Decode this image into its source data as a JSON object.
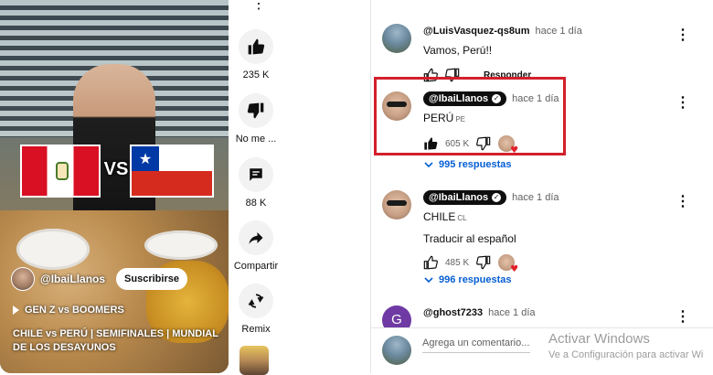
{
  "video": {
    "channel_name": "@IbaiLlanos",
    "subscribe_label": "Suscribirse",
    "playlist_label": "GEN Z vs BOOMERS",
    "title": "CHILE vs PERÚ | SEMIFINALES | MUNDIAL DE LOS DESAYUNOS",
    "vs_text": "VS",
    "flag_star": "★"
  },
  "actions": {
    "like_count": "235 K",
    "dislike_label": "No me ...",
    "comment_count": "88 K",
    "share_label": "Compartir",
    "remix_label": "Remix",
    "top_more": "⋮"
  },
  "comments": [
    {
      "author": "@LuisVasquez-qs8um",
      "time": "hace 1 día",
      "text": "Vamos, Perú!!",
      "reply_label": "Responder"
    },
    {
      "author": "@IbaiLlanos",
      "verified_mark": "✓",
      "time": "hace 1 día",
      "text": "PERÚ",
      "flag_code": "PE",
      "likes": "605 K",
      "replies": "995 respuestas"
    },
    {
      "author": "@IbaiLlanos",
      "verified_mark": "✓",
      "time": "hace 1 día",
      "text": "CHILE",
      "flag_code": "CL",
      "translate": "Traducir al español",
      "likes": "485 K",
      "replies": "996 respuestas"
    },
    {
      "author": "@ghost7233",
      "avatar_letter": "G",
      "time": "hace 1 día"
    }
  ],
  "add_comment": {
    "placeholder": "Agrega un comentario..."
  },
  "kebab": "⋮",
  "watermark": {
    "line1": "Activar Windows",
    "line2": "Ve a Configuración para activar Wi"
  },
  "colors": {
    "highlight": "#d3202a",
    "link": "#065fd4",
    "like_active": "#0f0f0f"
  }
}
